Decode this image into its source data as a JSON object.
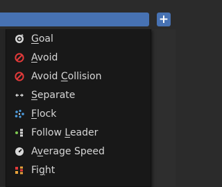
{
  "header": {
    "add_button_label": "+"
  },
  "menu": {
    "items": [
      {
        "name": "goal",
        "label": "Goal",
        "underline_index": 0,
        "icon": "goal-icon"
      },
      {
        "name": "avoid",
        "label": "Avoid",
        "underline_index": 0,
        "icon": "avoid-icon"
      },
      {
        "name": "avoid-collision",
        "label": "Avoid Collision",
        "underline_index": 6,
        "icon": "avoid-collision-icon"
      },
      {
        "name": "separate",
        "label": "Separate",
        "underline_index": 0,
        "icon": "separate-icon"
      },
      {
        "name": "flock",
        "label": "Flock",
        "underline_index": 0,
        "icon": "flock-icon"
      },
      {
        "name": "follow-leader",
        "label": "Follow Leader",
        "underline_index": 7,
        "icon": "follow-leader-icon"
      },
      {
        "name": "average-speed",
        "label": "Average Speed",
        "underline_index": 1,
        "icon": "average-speed-icon"
      },
      {
        "name": "fight",
        "label": "Fight",
        "underline_index": 2,
        "icon": "fight-icon"
      }
    ]
  },
  "colors": {
    "accent_blue": "#4772b3",
    "menu_bg": "#181818",
    "text": "#d6d6d6",
    "avoid_red": "#e33a3a"
  }
}
